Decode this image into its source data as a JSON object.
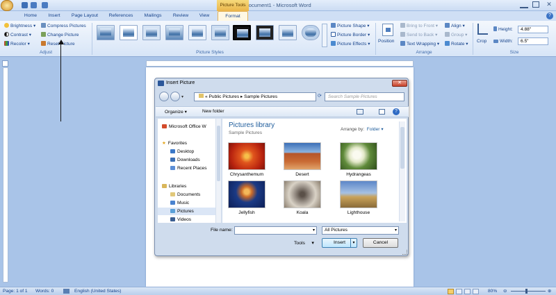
{
  "window": {
    "title": "Document1 - Microsoft Word",
    "context_tab": "Picture Tools"
  },
  "tabs": [
    "Home",
    "Insert",
    "Page Layout",
    "References",
    "Mailings",
    "Review",
    "View",
    "Format"
  ],
  "ribbon": {
    "adjust": {
      "items": [
        "Brightness",
        "Contrast",
        "Recolor",
        "Compress Pictures",
        "Change Picture",
        "Reset Picture"
      ],
      "label": "Adjust"
    },
    "picture_styles": {
      "label": "Picture Styles",
      "count": 10,
      "items": [
        "Picture Shape",
        "Picture Border",
        "Picture Effects"
      ]
    },
    "arrange": {
      "label": "Arrange",
      "position": "Position",
      "items": [
        "Bring to Front",
        "Send to Back",
        "Text Wrapping",
        "Align",
        "Group",
        "Rotate"
      ]
    },
    "size": {
      "label": "Size",
      "crop": "Crop",
      "height_label": "Height:",
      "height": "4.88\"",
      "width_label": "Width:",
      "width": "6.5\""
    }
  },
  "dialog": {
    "title": "Insert Picture",
    "path": [
      "Public Pictures",
      "Sample Pictures"
    ],
    "search_placeholder": "Search Sample Pictures",
    "organize": "Organize",
    "new_folder": "New folder",
    "nav": {
      "office": "Microsoft Office W",
      "favorites": "Favorites",
      "desktop": "Desktop",
      "downloads": "Downloads",
      "recent": "Recent Places",
      "libraries": "Libraries",
      "documents": "Documents",
      "music": "Music",
      "pictures": "Pictures",
      "videos": "Videos"
    },
    "library_title": "Pictures library",
    "library_subtitle": "Sample Pictures",
    "arrange_by_label": "Arrange by:",
    "arrange_by_value": "Folder",
    "files": [
      "Chrysanthemum",
      "Desert",
      "Hydrangeas",
      "Jellyfish",
      "Koala",
      "Lighthouse"
    ],
    "file_name_label": "File name:",
    "file_name_value": "",
    "file_type": "All Pictures",
    "tools": "Tools",
    "insert": "Insert",
    "cancel": "Cancel"
  },
  "status": {
    "page": "Page: 1 of 1",
    "words": "Words: 0",
    "language": "English (United States)",
    "zoom": "80%"
  }
}
